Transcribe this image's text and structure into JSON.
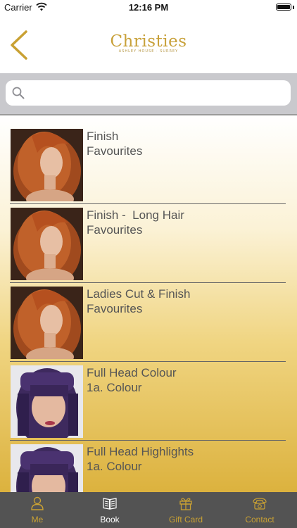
{
  "status_bar": {
    "carrier": "Carrier",
    "time": "12:16 PM"
  },
  "header": {
    "logo_text": "Christies",
    "logo_subtext": "ASHLEY HOUSE · SURREY"
  },
  "search": {
    "placeholder": ""
  },
  "services": [
    {
      "title": "Finish",
      "category": "Favourites",
      "image": "woman-red-hair"
    },
    {
      "title": "Finish -  Long Hair",
      "category": "Favourites",
      "image": "woman-red-hair"
    },
    {
      "title": "Ladies Cut & Finish",
      "category": "Favourites",
      "image": "woman-red-hair"
    },
    {
      "title": "Full Head Colour",
      "category": "1a. Colour",
      "image": "woman-purple-bob"
    },
    {
      "title": "Full Head Highlights",
      "category": "1a. Colour",
      "image": "woman-purple-bob"
    }
  ],
  "tabs": [
    {
      "label": "Me",
      "icon": "person-icon"
    },
    {
      "label": "Book",
      "icon": "book-icon"
    },
    {
      "label": "Gift Card",
      "icon": "gift-icon"
    },
    {
      "label": "Contact",
      "icon": "telephone-icon"
    }
  ],
  "colors": {
    "accent": "#C9A133",
    "tab_bar": "#535353",
    "active_tab": "#FFFFFF"
  }
}
